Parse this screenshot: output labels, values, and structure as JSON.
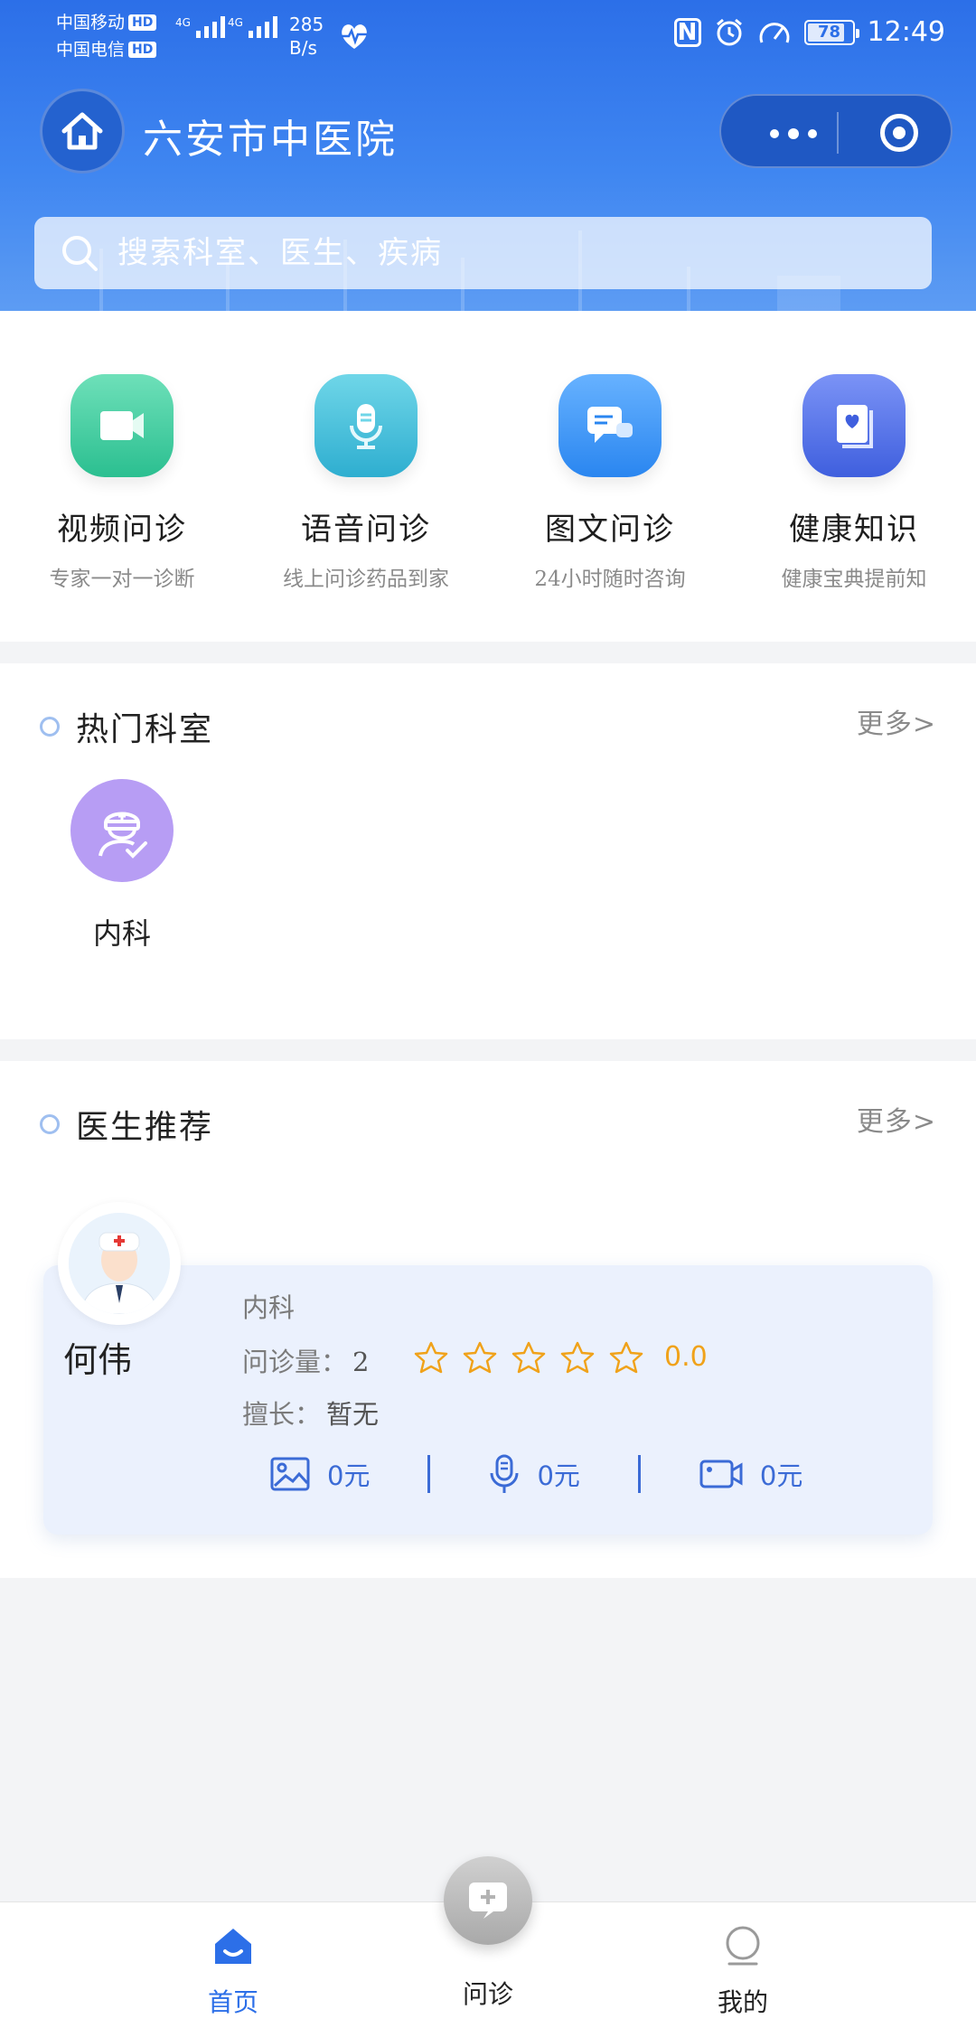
{
  "status_bar": {
    "carrier1": "中国移动",
    "carrier2": "中国电信",
    "hd": "HD",
    "network1": "4G",
    "network2": "4G",
    "speed_value": "285",
    "speed_unit": "B/s",
    "nfc": "N",
    "battery": "78",
    "time": "12:49"
  },
  "header": {
    "title": "六安市中医院"
  },
  "search": {
    "placeholder": "搜索科室、医生、疾病"
  },
  "services": [
    {
      "title": "视频问诊",
      "subtitle": "专家一对一诊断",
      "color_top": "#6ee0b9",
      "color_bottom": "#2bbf90",
      "icon": "video-icon"
    },
    {
      "title": "语音问诊",
      "subtitle": "线上问诊药品到家",
      "color_top": "#6fd6e8",
      "color_bottom": "#2eaed0",
      "icon": "microphone-icon"
    },
    {
      "title": "图文问诊",
      "subtitle": "24小时随时咨询",
      "color_top": "#67b2ff",
      "color_bottom": "#2a86f0",
      "icon": "chat-icon"
    },
    {
      "title": "健康知识",
      "subtitle": "健康宝典提前知",
      "color_top": "#7b93f6",
      "color_bottom": "#3f5fde",
      "icon": "book-icon"
    }
  ],
  "departments": {
    "title": "热门科室",
    "more": "更多>",
    "items": [
      {
        "name": "内科",
        "icon": "doctor-check-icon",
        "color": "#b79df4"
      }
    ]
  },
  "doctors": {
    "title": "医生推荐",
    "more": "更多>",
    "items": [
      {
        "name": "何伟",
        "department": "内科",
        "consult_label": "问诊量：",
        "consult_count": "2",
        "rating_stars": 0,
        "rating_max": 5,
        "score": "0.0",
        "specialty_label": "擅长：",
        "specialty": "暂无",
        "prices": [
          {
            "icon": "image-icon",
            "value": "0元"
          },
          {
            "icon": "microphone-icon",
            "value": "0元"
          },
          {
            "icon": "video-icon",
            "value": "0元"
          }
        ]
      }
    ]
  },
  "tabbar": {
    "items": [
      {
        "label": "首页",
        "icon": "home-icon",
        "active": true
      },
      {
        "label": "问诊",
        "icon": "consult-plus-icon",
        "active": false
      },
      {
        "label": "我的",
        "icon": "user-icon",
        "active": false
      }
    ]
  },
  "colors": {
    "primary": "#2c6fe8",
    "accent_blue": "#3b6bd6",
    "star": "#f0a21a",
    "card_bg": "#ebf1fd"
  }
}
